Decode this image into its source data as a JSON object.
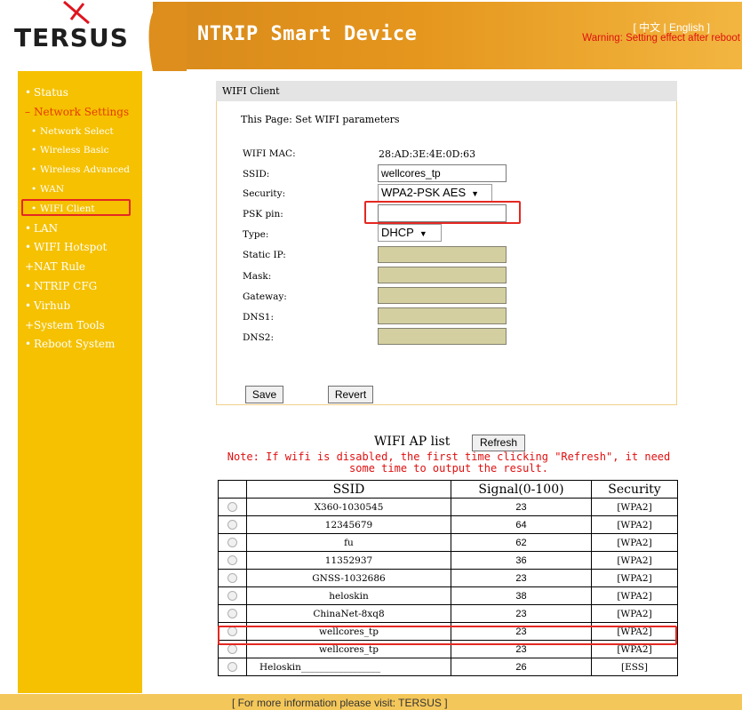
{
  "header": {
    "logo_text": "TERSUS",
    "title": "NTRIP Smart Device",
    "lang_open": "[",
    "lang_chinese": "中文",
    "lang_sep": "|",
    "lang_english": "English",
    "lang_close": "]",
    "warning": "Warning: Setting effect after reboot"
  },
  "sidebar": {
    "items": [
      {
        "bullet": "•",
        "label": "Status"
      },
      {
        "bullet": "–",
        "label": "Network Settings"
      },
      {
        "bullet": "•",
        "label": "Network Select"
      },
      {
        "bullet": "•",
        "label": "Wireless Basic"
      },
      {
        "bullet": "•",
        "label": "Wireless Advanced"
      },
      {
        "bullet": "•",
        "label": "WAN"
      },
      {
        "bullet": "•",
        "label": "WIFI Client"
      },
      {
        "bullet": "•",
        "label": "LAN"
      },
      {
        "bullet": "•",
        "label": "WIFI Hotspot"
      },
      {
        "bullet": "+",
        "label": "NAT Rule"
      },
      {
        "bullet": "•",
        "label": "NTRIP CFG"
      },
      {
        "bullet": "•",
        "label": "Virhub"
      },
      {
        "bullet": "+",
        "label": "System Tools"
      },
      {
        "bullet": "•",
        "label": "Reboot System"
      }
    ]
  },
  "panel": {
    "title": "WIFI Client",
    "description": "This Page: Set WIFI parameters",
    "labels": {
      "mac": "WIFI MAC:",
      "ssid": "SSID:",
      "security": "Security:",
      "psk": "PSK pin:",
      "type": "Type:",
      "static_ip": "Static IP:",
      "mask": "Mask:",
      "gateway": "Gateway:",
      "dns1": "DNS1:",
      "dns2": "DNS2:"
    },
    "mac_value": "28:AD:3E:4E:0D:63",
    "ssid_value": "wellcores_tp",
    "security_value": "WPA2-PSK AES",
    "psk_value": "",
    "type_value": "DHCP",
    "save_label": "Save",
    "revert_label": "Revert"
  },
  "ap_list": {
    "title": "WIFI AP list",
    "refresh_label": "Refresh",
    "note_line1": "Note: If wifi is disabled, the first time clicking \"Refresh\", it need",
    "note_line2": "some time to output the result.",
    "columns": [
      "",
      "SSID",
      "Signal(0-100)",
      "Security"
    ],
    "rows": [
      {
        "ssid": "X360-1030545",
        "signal": "23",
        "security": "[WPA2]"
      },
      {
        "ssid": "12345679",
        "signal": "64",
        "security": "[WPA2]"
      },
      {
        "ssid": "fu",
        "signal": "62",
        "security": "[WPA2]"
      },
      {
        "ssid": "11352937",
        "signal": "36",
        "security": "[WPA2]"
      },
      {
        "ssid": "GNSS-1032686",
        "signal": "23",
        "security": "[WPA2]"
      },
      {
        "ssid": "heloskin",
        "signal": "38",
        "security": "[WPA2]"
      },
      {
        "ssid": "ChinaNet-8xq8",
        "signal": "23",
        "security": "[WPA2]"
      },
      {
        "ssid": "wellcores_tp",
        "signal": "23",
        "security": "[WPA2]"
      },
      {
        "ssid": "wellcores_tp",
        "signal": "23",
        "security": "[WPA2]"
      },
      {
        "ssid": "Heloskin_________________",
        "signal": "26",
        "security": "[ESS]"
      }
    ]
  },
  "footer": {
    "text": "[ For more information please visit: TERSUS ]"
  },
  "colors": {
    "sidebar": "#f5c100",
    "header_orange": "#e5961d",
    "highlight_red": "#e42822",
    "note_red": "#e01010"
  }
}
